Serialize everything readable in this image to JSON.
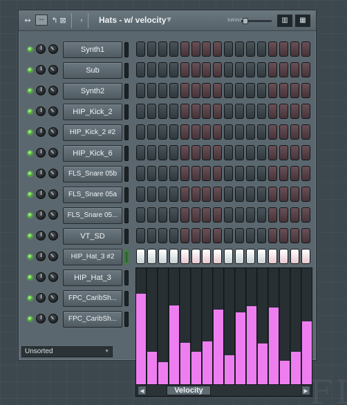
{
  "window": {
    "pattern_name": "Hats - w/ velocity",
    "swing_label": "SWING",
    "title_icons": [
      "arrows-icon",
      "minus-icon",
      "undo-icon",
      "close-icon",
      "play-icon"
    ],
    "view_icons": [
      "bars-view-icon",
      "keys-view-icon"
    ]
  },
  "channels": [
    {
      "name": "Synth1",
      "active": false
    },
    {
      "name": "Sub",
      "active": false
    },
    {
      "name": "Synth2",
      "active": false
    },
    {
      "name": "HIP_Kick_2",
      "active": false
    },
    {
      "name": "HIP_Kick_2 #2",
      "active": false
    },
    {
      "name": "HIP_Kick_6",
      "active": false
    },
    {
      "name": "FLS_Snare 05b",
      "active": false
    },
    {
      "name": "FLS_Snare 05a",
      "active": false
    },
    {
      "name": "FLS_Snare 05...",
      "active": false
    },
    {
      "name": "VT_SD",
      "active": false
    },
    {
      "name": "HIP_Hat_3 #2",
      "active": true
    },
    {
      "name": "HIP_Hat_3",
      "active": false
    },
    {
      "name": "FPC_CaribSh...",
      "active": false
    },
    {
      "name": "FPC_CaribSh...",
      "active": false
    }
  ],
  "step_groups": [
    "grey",
    "red",
    "grey",
    "red"
  ],
  "status": {
    "filter": "Unsorted"
  },
  "velocity": {
    "label": "Velocity",
    "color": "#ee7ef0",
    "levels": [
      0.78,
      0.28,
      0.19,
      0.68,
      0.36,
      0.28,
      0.37,
      0.64,
      0.25,
      0.62,
      0.67,
      0.35,
      0.66,
      0.2,
      0.28,
      0.54
    ]
  },
  "colors": {
    "led": "#4caf2f",
    "step_on": "#ffffff",
    "velocity": "#ee7ef0"
  }
}
